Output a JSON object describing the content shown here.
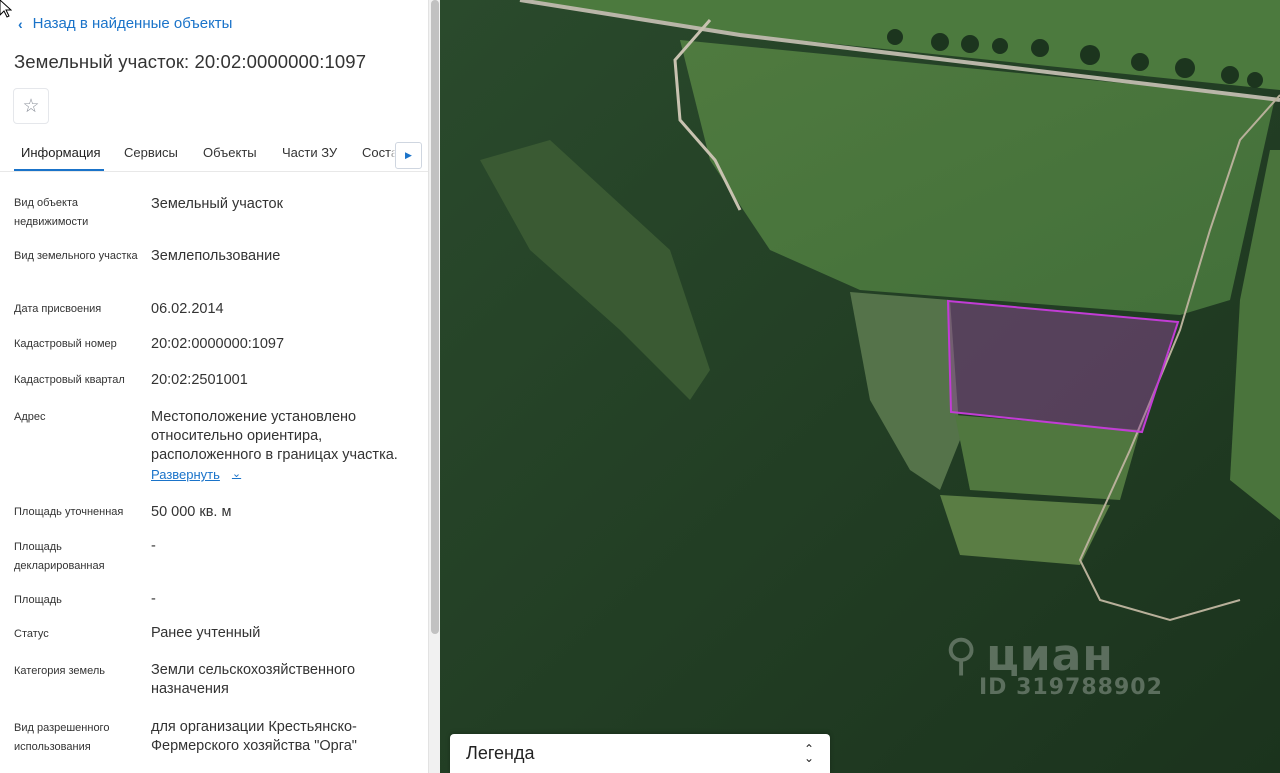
{
  "back_link": "Назад в найденные объекты",
  "title": "Земельный участок: 20:02:0000000:1097",
  "tabs": [
    {
      "label": "Информация"
    },
    {
      "label": "Сервисы"
    },
    {
      "label": "Объекты"
    },
    {
      "label": "Части ЗУ"
    },
    {
      "label": "Состав"
    }
  ],
  "fields": [
    {
      "label": "Вид объекта недвижимости",
      "value": "Земельный участок"
    },
    {
      "label": "Вид земельного участка",
      "value": "Землепользование"
    },
    {
      "label": "Дата присвоения",
      "value": "06.02.2014"
    },
    {
      "label": "Кадастровый номер",
      "value": "20:02:0000000:1097"
    },
    {
      "label": "Кадастровый квартал",
      "value": "20:02:2501001"
    },
    {
      "label": "Адрес",
      "value": "Местоположение установлено относительно ориентира, расположенного в границах участка.",
      "expand": "Развернуть"
    },
    {
      "label": "Площадь уточненная",
      "value": "50 000 кв. м"
    },
    {
      "label": "Площадь декларированная",
      "value": "-"
    },
    {
      "label": "Площадь",
      "value": "-"
    },
    {
      "label": "Статус",
      "value": "Ранее учтенный"
    },
    {
      "label": "Категория земель",
      "value": "Земли сельскохозяйственного назначения"
    },
    {
      "label": "Вид разрешенного использования",
      "value": "для организации Крестьянско-Фермерского хозяйства \"Орга\""
    }
  ],
  "watermark": {
    "brand": "циан",
    "id": "ID 319788902"
  },
  "legend": {
    "title": "Легенда"
  },
  "colors": {
    "accent": "#1a73c9",
    "parcel_outline": "#c23cd6"
  },
  "icons": {
    "back": "chevron-left-icon",
    "favorite": "star-icon",
    "tabs_scroll": "caret-right-icon",
    "expand": "chevron-down-icon",
    "legend_toggle": "up-down-chevron-icon",
    "watermark": "location-pin-icon"
  }
}
